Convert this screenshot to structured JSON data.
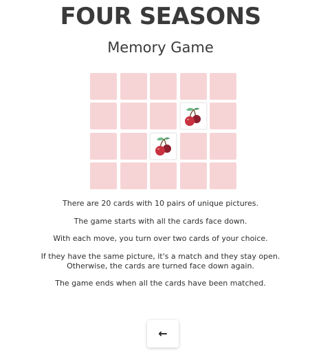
{
  "title": "FOUR SEASONS",
  "subtitle": "Memory Game",
  "colors": {
    "card_back": "#f6d4d6",
    "card_face": "#ffffff",
    "cherry_red": "#c8323f",
    "cherry_dark": "#8e1f2e",
    "leaf_green": "#6fb98a"
  },
  "board": {
    "columns": 5,
    "rows": 4,
    "total_cards": 20,
    "cards": [
      {
        "state": "face-down"
      },
      {
        "state": "face-down"
      },
      {
        "state": "face-down"
      },
      {
        "state": "face-down"
      },
      {
        "state": "face-down"
      },
      {
        "state": "face-down"
      },
      {
        "state": "face-down"
      },
      {
        "state": "face-down"
      },
      {
        "state": "face-up",
        "picture": "cherries-icon"
      },
      {
        "state": "face-down"
      },
      {
        "state": "face-down"
      },
      {
        "state": "face-down"
      },
      {
        "state": "face-up",
        "picture": "cherries-icon"
      },
      {
        "state": "face-down"
      },
      {
        "state": "face-down"
      },
      {
        "state": "face-down"
      },
      {
        "state": "face-down"
      },
      {
        "state": "face-down"
      },
      {
        "state": "face-down"
      },
      {
        "state": "face-down"
      }
    ]
  },
  "rules": {
    "line1": "There are 20 cards with 10 pairs of unique pictures.",
    "line2": "The game starts with all the cards face down.",
    "line3": "With each move, you turn over two cards of your choice.",
    "line4a": "If they have the same picture, it's a match and they stay open.",
    "line4b": "Otherwise, the cards are turned face down again.",
    "line5": "The game ends when all the cards have been matched."
  },
  "back_button": {
    "label": "←",
    "icon": "arrow-left-icon"
  }
}
